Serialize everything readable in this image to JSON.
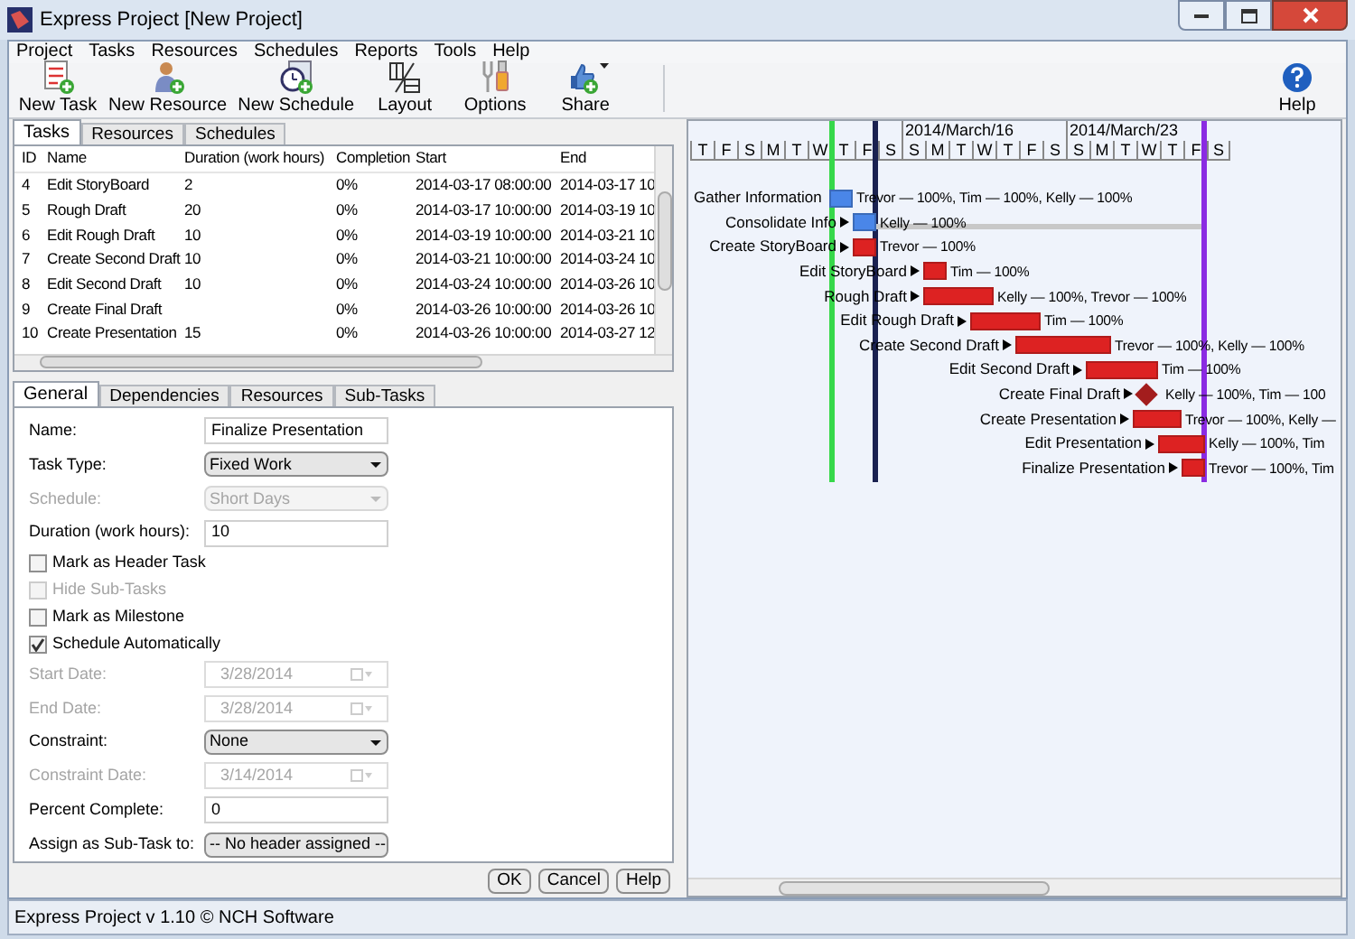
{
  "window": {
    "title": "Express Project [New Project]"
  },
  "menu": [
    "Project",
    "Tasks",
    "Resources",
    "Schedules",
    "Reports",
    "Tools",
    "Help"
  ],
  "toolbar": [
    {
      "label": "New Task",
      "kind": "new-task"
    },
    {
      "label": "New Resource",
      "kind": "new-resource"
    },
    {
      "label": "New Schedule",
      "kind": "new-schedule"
    },
    {
      "label": "Layout",
      "kind": "layout"
    },
    {
      "label": "Options",
      "kind": "options"
    },
    {
      "label": "Share",
      "kind": "share"
    },
    {
      "label": "Help",
      "kind": "help"
    }
  ],
  "tabs": [
    {
      "label": "Tasks",
      "selected": true
    },
    {
      "label": "Resources",
      "selected": false
    },
    {
      "label": "Schedules",
      "selected": false
    }
  ],
  "table": {
    "columns": [
      "ID",
      "Name",
      "Duration (work hours)",
      "Completion",
      "Start",
      "End"
    ],
    "rows": [
      [
        "4",
        "Edit StoryBoard",
        "2",
        "0%",
        "2014-03-17 08:00:00",
        "2014-03-17 10"
      ],
      [
        "5",
        "Rough Draft",
        "20",
        "0%",
        "2014-03-17 10:00:00",
        "2014-03-19 10"
      ],
      [
        "6",
        "Edit Rough Draft",
        "10",
        "0%",
        "2014-03-19 10:00:00",
        "2014-03-21 10"
      ],
      [
        "7",
        "Create Second Draft",
        "10",
        "0%",
        "2014-03-21 10:00:00",
        "2014-03-24 10"
      ],
      [
        "8",
        "Edit Second Draft",
        "10",
        "0%",
        "2014-03-24 10:00:00",
        "2014-03-26 10"
      ],
      [
        "9",
        "Create Final Draft",
        "",
        "0%",
        "2014-03-26 10:00:00",
        "2014-03-26 10"
      ],
      [
        "10",
        "Create Presentation",
        "15",
        "0%",
        "2014-03-26 10:00:00",
        "2014-03-27 12"
      ]
    ]
  },
  "form_tabs": [
    {
      "label": "General",
      "selected": true
    },
    {
      "label": "Dependencies",
      "selected": false
    },
    {
      "label": "Resources",
      "selected": false
    },
    {
      "label": "Sub-Tasks",
      "selected": false
    }
  ],
  "form": [
    {
      "kind": "text",
      "label": "Name:",
      "value": "Finalize Presentation",
      "disabled": false
    },
    {
      "kind": "select",
      "label": "Task Type:",
      "value": "Fixed Work",
      "disabled": false
    },
    {
      "kind": "select",
      "label": "Schedule:",
      "value": "Short Days",
      "disabled": true
    },
    {
      "kind": "text",
      "label": "Duration (work hours):",
      "value": "10",
      "disabled": false
    },
    {
      "kind": "checkbox",
      "label": "Mark as Header Task",
      "checked": false,
      "disabled": false
    },
    {
      "kind": "checkbox",
      "label": "Hide Sub-Tasks",
      "checked": false,
      "disabled": true
    },
    {
      "kind": "checkbox",
      "label": "Mark as Milestone",
      "checked": false,
      "disabled": false
    },
    {
      "kind": "checkbox",
      "label": "Schedule Automatically",
      "checked": true,
      "disabled": false
    },
    {
      "kind": "date",
      "label": "Start Date:",
      "value": "3/28/2014",
      "disabled": true
    },
    {
      "kind": "date",
      "label": "End Date:",
      "value": "3/28/2014",
      "disabled": true
    },
    {
      "kind": "select",
      "label": "Constraint:",
      "value": "None",
      "disabled": false
    },
    {
      "kind": "date",
      "label": "Constraint Date:",
      "value": "3/14/2014",
      "disabled": true
    },
    {
      "kind": "text",
      "label": "Percent Complete:",
      "value": "0",
      "disabled": false
    },
    {
      "kind": "select",
      "label": "Assign as Sub-Task to:",
      "value": "-- No header assigned --",
      "disabled": false
    }
  ],
  "dialog_buttons": [
    "OK",
    "Cancel",
    "Help"
  ],
  "gantt": {
    "weeks": [
      "2014/March/16",
      "2014/March/23"
    ],
    "days": [
      "T",
      "F",
      "S",
      "M",
      "T",
      "W",
      "T",
      "F",
      "S",
      "S",
      "M",
      "T",
      "W",
      "T",
      "F",
      "S",
      "S",
      "M",
      "T",
      "W",
      "T",
      "F",
      "S"
    ],
    "tasks": [
      {
        "name": "Gather Information",
        "resources": "Trevor — 100%, Tim — 100%, Kelly — 100%",
        "kind": "bar",
        "color": "#4a86e8"
      },
      {
        "name": "Consolidate Info",
        "resources": "Kelly — 100%",
        "kind": "bar",
        "color": "#4a86e8"
      },
      {
        "name": "Create StoryBoard",
        "resources": "Trevor — 100%",
        "kind": "bar",
        "color": "#dd2222"
      },
      {
        "name": "Edit StoryBoard",
        "resources": "Tim — 100%",
        "kind": "bar",
        "color": "#dd2222"
      },
      {
        "name": "Rough Draft",
        "resources": "Kelly — 100%, Trevor — 100%",
        "kind": "bar",
        "color": "#dd2222"
      },
      {
        "name": "Edit Rough Draft",
        "resources": "Tim — 100%",
        "kind": "bar",
        "color": "#dd2222"
      },
      {
        "name": "Create Second Draft",
        "resources": "Trevor — 100%, Kelly — 100%",
        "kind": "bar",
        "color": "#dd2222"
      },
      {
        "name": "Edit Second Draft",
        "resources": "Tim — 100%",
        "kind": "bar",
        "color": "#dd2222"
      },
      {
        "name": "Create Final Draft",
        "resources": "Kelly — 100%, Tim — 100",
        "kind": "milestone",
        "color": "#a31d1d"
      },
      {
        "name": "Create Presentation",
        "resources": "Trevor — 100%, Kelly —",
        "kind": "bar",
        "color": "#dd2222"
      },
      {
        "name": "Edit Presentation",
        "resources": "Kelly — 100%, Tim",
        "kind": "bar",
        "color": "#dd2222"
      },
      {
        "name": "Finalize Presentation",
        "resources": "Trevor — 100%, Tim",
        "kind": "bar",
        "color": "#dd2222"
      }
    ]
  },
  "status_bar": "Express Project v 1.10 © NCH Software"
}
